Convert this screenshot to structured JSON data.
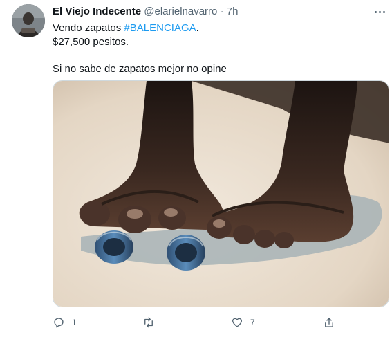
{
  "author": {
    "display_name": "El Viejo Indecente",
    "handle": "@elarielnavarro",
    "separator": "·",
    "timestamp": "7h"
  },
  "tweet": {
    "line1_prefix": "Vendo zapatos ",
    "hashtag": "#BALENCIAGA",
    "line1_suffix": ".",
    "line2": "$27,500 pesitos.",
    "line3": "Si no sabe de zapatos mejor no opine"
  },
  "actions": {
    "reply_count": "1",
    "like_count": "7"
  },
  "colors": {
    "accent": "#1d9bf0",
    "secondary_text": "#536471",
    "primary_text": "#0f1419"
  },
  "icons": [
    "more-options-icon",
    "reply-icon",
    "retweet-icon",
    "like-icon",
    "share-icon"
  ]
}
